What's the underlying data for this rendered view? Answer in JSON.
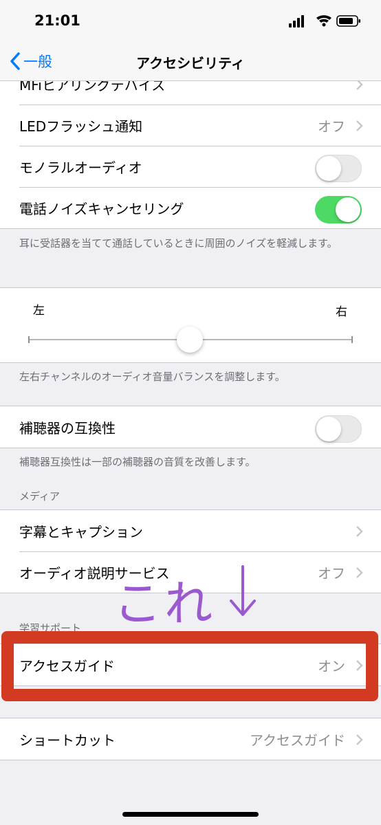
{
  "status_bar": {
    "time": "21:01"
  },
  "nav": {
    "back_label": "一般",
    "title": "アクセシビリティ"
  },
  "rows": {
    "mfi": "MFiヒアリングデバイス",
    "led_label": "LEDフラッシュ通知",
    "led_value": "オフ",
    "mono_label": "モノラルオーディオ",
    "noise_label": "電話ノイズキャンセリング",
    "noise_footer": "耳に受話器を当てて通話しているときに周囲のノイズを軽減します。",
    "hearing_label": "補聴器の互換性",
    "hearing_footer": "補聴器互換性は一部の補聴器の音質を改善します。",
    "subtitles_label": "字幕とキャプション",
    "audio_desc_label": "オーディオ説明サービス",
    "audio_desc_value": "オフ",
    "guided_label": "アクセスガイド",
    "guided_value": "オン",
    "shortcut_label": "ショートカット",
    "shortcut_value": "アクセスガイド"
  },
  "balance": {
    "left": "左",
    "right": "右",
    "footer": "左右チャンネルのオーディオ音量バランスを調整します。",
    "value": 0.5
  },
  "sections": {
    "media": "メディア",
    "learning": "学習サポート"
  },
  "toggles": {
    "mono": false,
    "noise": true,
    "hearing": false
  },
  "annotation": {
    "text": "これ",
    "arrow": "↓"
  },
  "colors": {
    "accent": "#007aff",
    "toggle_on": "#4cd964",
    "annotation": "#9b59d0",
    "highlight": "#d33a22"
  }
}
